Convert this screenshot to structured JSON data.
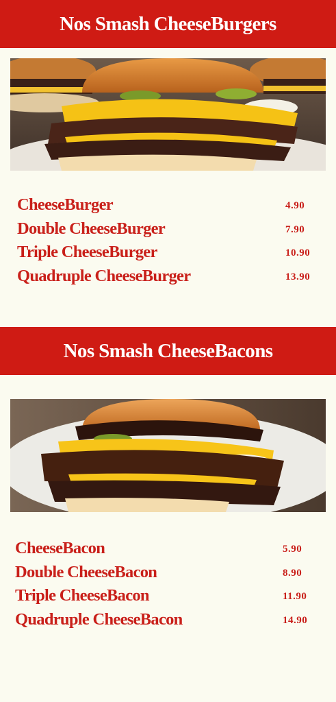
{
  "sections": [
    {
      "title": "Nos Smash CheeseBurgers",
      "image": "smash-cheeseburger-photo",
      "items": [
        {
          "name": "CheeseBurger",
          "price": "4.90"
        },
        {
          "name": "Double CheeseBurger",
          "price": "7.90"
        },
        {
          "name": "Triple CheeseBurger",
          "price": "10.90"
        },
        {
          "name": "Quadruple CheeseBurger",
          "price": "13.90"
        }
      ]
    },
    {
      "title": "Nos Smash CheeseBacons",
      "image": "smash-cheesebacon-photo",
      "items": [
        {
          "name": "CheeseBacon",
          "price": "5.90"
        },
        {
          "name": "Double CheeseBacon",
          "price": "8.90"
        },
        {
          "name": "Triple CheeseBacon",
          "price": "11.90"
        },
        {
          "name": "Quadruple CheeseBacon",
          "price": "14.90"
        }
      ]
    }
  ],
  "colors": {
    "banner_background": "#cf1b14",
    "banner_text": "#ffffff",
    "menu_text": "#c9201a",
    "page_background": "#fbfbf0"
  }
}
